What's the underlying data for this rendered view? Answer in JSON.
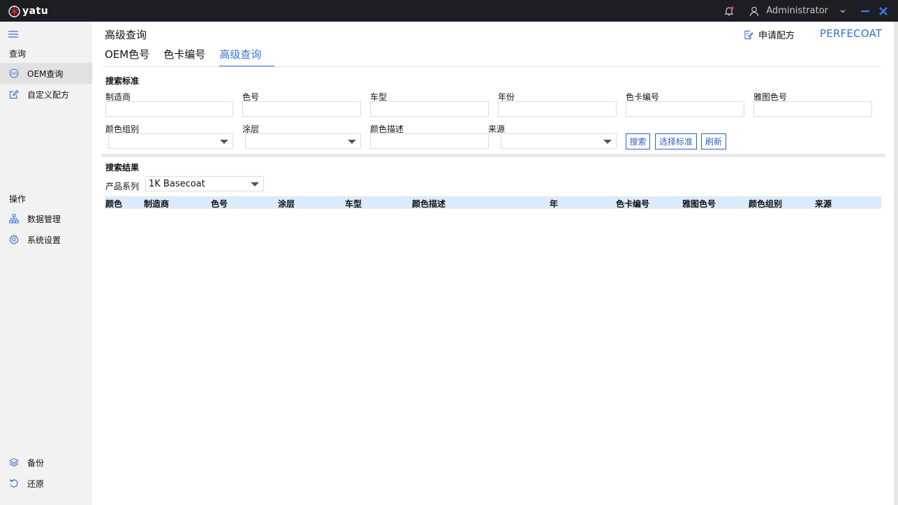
{
  "titlebar": {
    "brand": "yatu",
    "user_name": "Administrator"
  },
  "sidebar": {
    "section_query": "查询",
    "items_query": [
      {
        "label": "OEM查询",
        "icon": "oem-icon",
        "active": true
      },
      {
        "label": "自定义配方",
        "icon": "edit-icon",
        "active": false
      }
    ],
    "section_ops": "操作",
    "items_ops": [
      {
        "label": "数据管理",
        "icon": "network-icon"
      },
      {
        "label": "系统设置",
        "icon": "gear-icon"
      }
    ],
    "items_bottom": [
      {
        "label": "备份",
        "icon": "layers-icon"
      },
      {
        "label": "还原",
        "icon": "undo-icon"
      }
    ]
  },
  "header": {
    "page_title": "高级查询",
    "apply_label": "申请配方",
    "brand": "PERFECOAT"
  },
  "tabs": [
    {
      "label": "OEM色号",
      "active": false
    },
    {
      "label": "色卡编号",
      "active": false
    },
    {
      "label": "高级查询",
      "active": true
    }
  ],
  "search": {
    "title": "搜索标准",
    "fields_row1": [
      {
        "label": "制造商",
        "value": ""
      },
      {
        "label": "色号",
        "value": ""
      },
      {
        "label": "车型",
        "value": ""
      },
      {
        "label": "年份",
        "value": ""
      },
      {
        "label": "色卡编号",
        "value": ""
      },
      {
        "label": "雅图色号",
        "value": ""
      }
    ],
    "fields_row2": [
      {
        "label": "颜色组别",
        "value": "",
        "type": "select"
      },
      {
        "label": "涂层",
        "value": "",
        "type": "select"
      },
      {
        "label": "颜色描述",
        "value": "",
        "type": "input"
      },
      {
        "label": "来源",
        "value": "",
        "type": "select"
      }
    ],
    "buttons": {
      "search": "搜索",
      "select_standard": "选择标准",
      "refresh": "刷新"
    }
  },
  "results": {
    "title": "搜索结果",
    "series_label": "产品系列",
    "series_value": "1K Basecoat",
    "columns": [
      "颜色",
      "制造商",
      "色号",
      "涂层",
      "车型",
      "颜色描述",
      "年",
      "色卡编号",
      "雅图色号",
      "颜色组别",
      "来源"
    ],
    "rows": []
  },
  "colors": {
    "accent": "#3b73d6",
    "titlebar_bg": "#1c1e24",
    "sidebar_bg": "#f2f2f2",
    "table_header_bg": "#dcebfb"
  }
}
